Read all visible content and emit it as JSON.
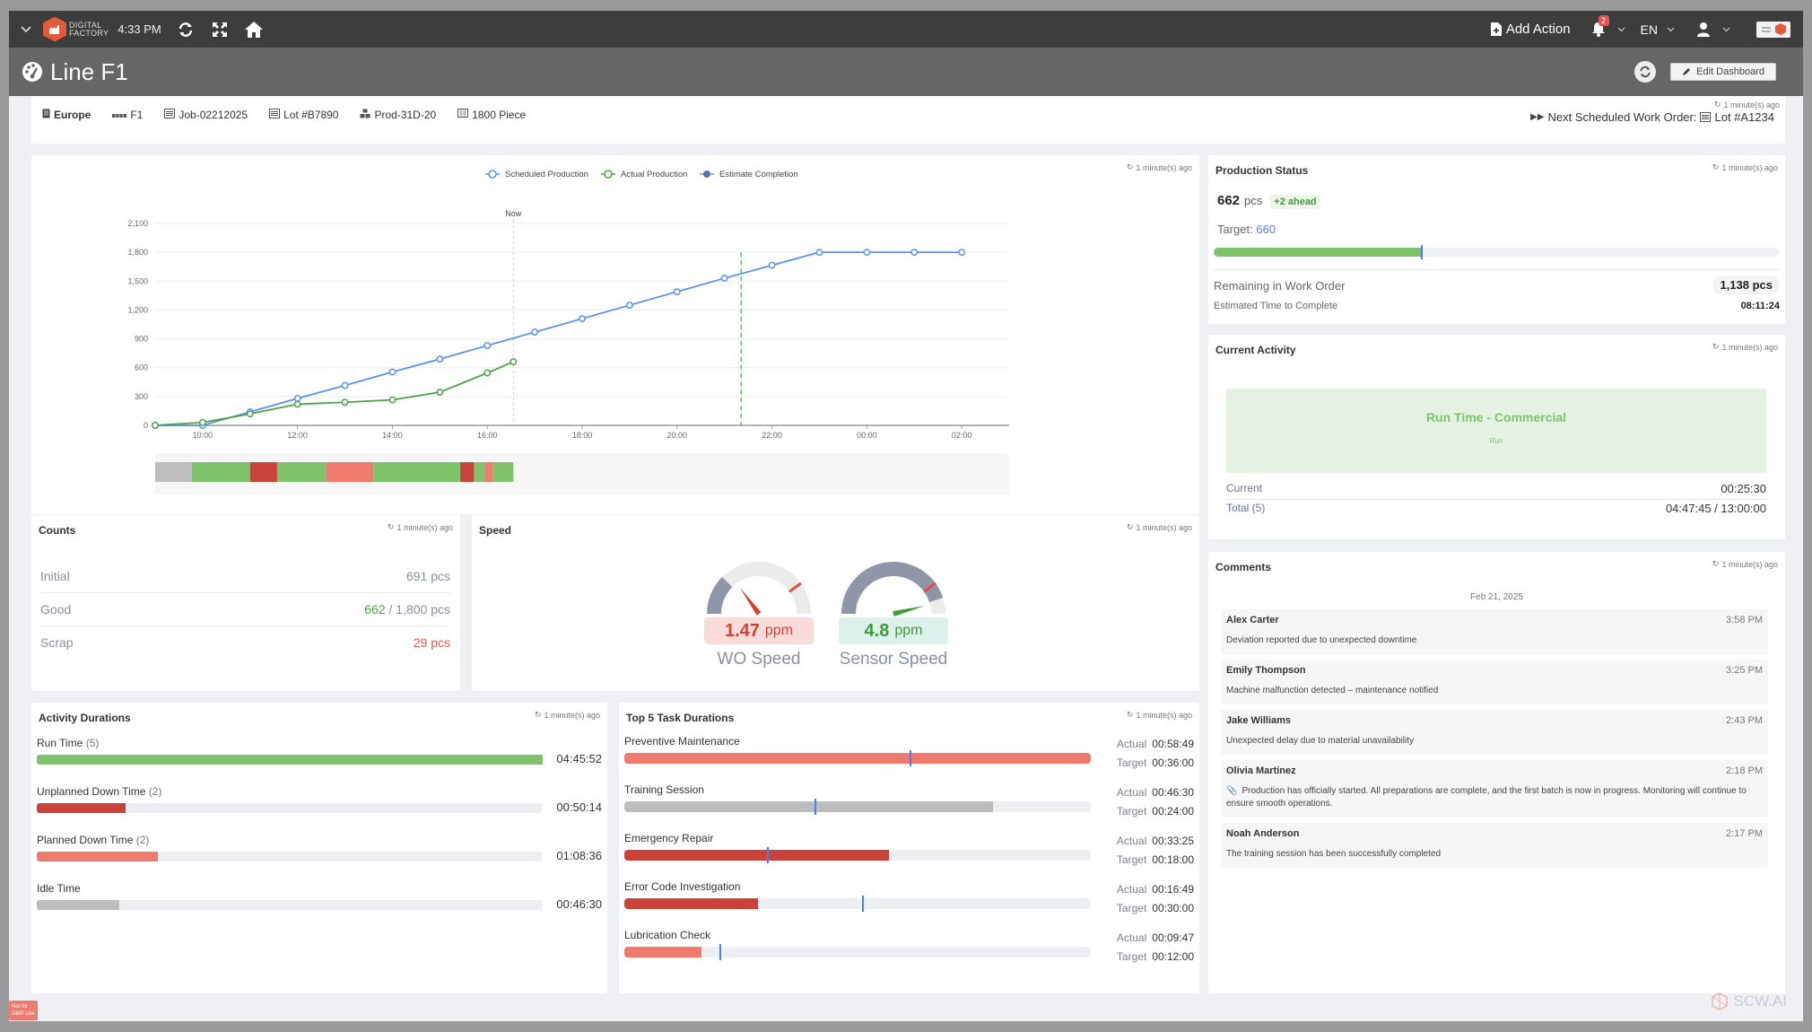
{
  "topbar": {
    "logo_line1": "DIGITAL",
    "logo_line2": "FACTORY",
    "time": "4:33 PM",
    "add_action_label": "Add Action",
    "notification_count": "2",
    "language": "EN",
    "icons": [
      "chevron-down-icon",
      "refresh-icon",
      "fullscreen-icon",
      "home-icon",
      "file-plus-icon",
      "bell-icon",
      "user-icon",
      "app-switch-icon"
    ]
  },
  "titlebar": {
    "title": "Line F1",
    "edit_dashboard_label": "Edit Dashboard"
  },
  "infobar": {
    "items": [
      {
        "icon": "building-icon",
        "label": "Europe"
      },
      {
        "icon": "line-icon",
        "label": "F1"
      },
      {
        "icon": "list-icon",
        "label": "Job-02212025"
      },
      {
        "icon": "list-icon",
        "label": "Lot #B7890"
      },
      {
        "icon": "boxes-icon",
        "label": "Prod-31D-20"
      },
      {
        "icon": "flag-icon",
        "label": "1800 Piece"
      }
    ],
    "updated": "1 minute(s) ago",
    "next_wo_label": "Next Scheduled Work Order:",
    "next_wo_value": "Lot #A1234"
  },
  "chart_panel": {
    "updated": "1 minute(s) ago"
  },
  "chart_data": {
    "type": "line",
    "title": "",
    "xlabel": "",
    "ylabel": "",
    "legend": [
      "Scheduled Production",
      "Actual Production",
      "Estimate Completion"
    ],
    "legend_position": "top-center",
    "x": [
      "09:00",
      "10:00",
      "11:00",
      "12:00",
      "13:00",
      "14:00",
      "15:00",
      "16:00",
      "17:00",
      "18:00",
      "19:00",
      "20:00",
      "21:00",
      "22:00",
      "23:00",
      "00:00",
      "01:00",
      "02:00"
    ],
    "x_hours": [
      9,
      10,
      11,
      12,
      13,
      14,
      15,
      16,
      17,
      18,
      19,
      20,
      21,
      22,
      23,
      24,
      25,
      26
    ],
    "xtick_labels": [
      "10:00",
      "12:00",
      "14:00",
      "16:00",
      "18:00",
      "20:00",
      "22:00",
      "00:00",
      "02:00"
    ],
    "xtick_hours": [
      10,
      12,
      14,
      16,
      18,
      20,
      22,
      24,
      26
    ],
    "xlim_hours": [
      9,
      27
    ],
    "ylim": [
      0,
      2100
    ],
    "yticks": [
      0,
      300,
      600,
      900,
      1200,
      1500,
      1800,
      2100
    ],
    "ytick_labels": [
      "0",
      "300",
      "600",
      "900",
      "1,200",
      "1,500",
      "1,800",
      "2,100"
    ],
    "grid": true,
    "series": [
      {
        "name": "Scheduled Production",
        "color": "#5b8ff0",
        "hours": [
          9,
          10,
          11,
          12,
          13,
          14,
          15,
          16,
          17,
          18,
          19,
          20,
          21,
          22,
          23,
          24,
          25,
          26
        ],
        "values": [
          0,
          0,
          140,
          280,
          415,
          555,
          690,
          830,
          970,
          1110,
          1250,
          1390,
          1530,
          1665,
          1800,
          1800,
          1800,
          1800
        ]
      },
      {
        "name": "Actual Production",
        "color": "#4ea048",
        "hours": [
          9,
          10,
          11,
          12,
          13,
          14,
          15,
          16,
          16.55
        ],
        "values": [
          0,
          30,
          120,
          220,
          240,
          265,
          345,
          545,
          662
        ]
      }
    ],
    "now_line": {
      "label": "Now",
      "hour": 16.55
    },
    "estimate_completion": {
      "hour": 21.35,
      "color": "#5fbf5a"
    },
    "timeline": {
      "start_hour": 9,
      "segments": [
        {
          "state": "idle",
          "from": 9.0,
          "to": 9.77,
          "color": "#bdbdbd"
        },
        {
          "state": "run",
          "from": 9.77,
          "to": 11.0,
          "color": "#7ec36b"
        },
        {
          "state": "unplanned-down",
          "from": 11.0,
          "to": 11.57,
          "color": "#c9433a"
        },
        {
          "state": "run",
          "from": 11.57,
          "to": 12.6,
          "color": "#7ec36b"
        },
        {
          "state": "planned-down",
          "from": 12.6,
          "to": 13.6,
          "color": "#ef7b6e"
        },
        {
          "state": "run",
          "from": 13.6,
          "to": 15.43,
          "color": "#7ec36b"
        },
        {
          "state": "unplanned-down",
          "from": 15.43,
          "to": 15.72,
          "color": "#c9433a"
        },
        {
          "state": "run",
          "from": 15.72,
          "to": 15.95,
          "color": "#7ec36b"
        },
        {
          "state": "planned-down",
          "from": 15.95,
          "to": 16.12,
          "color": "#ef7b6e"
        },
        {
          "state": "run",
          "from": 16.12,
          "to": 16.55,
          "color": "#7ec36b"
        }
      ]
    }
  },
  "production_status": {
    "title": "Production Status",
    "updated": "1 minute(s) ago",
    "count": "662",
    "unit": "pcs",
    "ahead_badge": "+2 ahead",
    "target_label": "Target:",
    "target_value": "660",
    "progress_fraction": 0.368,
    "target_fraction": 0.367,
    "remaining_label": "Remaining in Work Order",
    "remaining_value": "1,138 pcs",
    "etc_label": "Estimated Time to Complete",
    "etc_value": "08:11:24"
  },
  "current_activity": {
    "title": "Current Activity",
    "updated": "1 minute(s) ago",
    "activity_name": "Run Time - Commercial",
    "activity_type": "Run",
    "current_label": "Current",
    "current_value": "00:25:30",
    "total_label": "Total (5)",
    "total_value": "04:47:45 / 13:00:00"
  },
  "comments": {
    "title": "Comments",
    "updated": "1 minute(s) ago",
    "date": "Feb 21, 2025",
    "items": [
      {
        "author": "Alex Carter",
        "time": "3:58 PM",
        "text": "Deviation reported due to unexpected downtime",
        "attachment": false
      },
      {
        "author": "Emily Thompson",
        "time": "3:25 PM",
        "text": "Machine malfunction detected – maintenance notified",
        "attachment": false
      },
      {
        "author": "Jake Williams",
        "time": "2:43 PM",
        "text": "Unexpected delay due to material unavailability",
        "attachment": false
      },
      {
        "author": "Olivia Martinez",
        "time": "2:18 PM",
        "text": "Production has officially started. All preparations are complete, and the first batch is now in progress. Monitoring will continue to ensure smooth operations.",
        "attachment": true
      },
      {
        "author": "Noah Anderson",
        "time": "2:17 PM",
        "text": "The training session has been successfully completed",
        "attachment": false
      }
    ]
  },
  "counts": {
    "title": "Counts",
    "updated": "1 minute(s) ago",
    "initial_label": "Initial",
    "initial_value": "691 pcs",
    "good_label": "Good",
    "good_value": "662",
    "good_total": " / 1,800 pcs",
    "scrap_label": "Scrap",
    "scrap_value": "29 pcs"
  },
  "speed": {
    "title": "Speed",
    "updated": "1 minute(s) ago",
    "gauges": [
      {
        "label": "WO Speed",
        "value": "1.47",
        "unit": "ppm",
        "value_fraction": 0.3,
        "fill_fraction": 0.25,
        "target_fraction": 0.8,
        "status": "below",
        "color": "#d64034",
        "bg": "#f9dcda"
      },
      {
        "label": "Sensor Speed",
        "value": "4.8",
        "unit": "ppm",
        "value_fraction": 0.92,
        "fill_fraction": 0.9,
        "target_fraction": 0.8,
        "status": "above",
        "color": "#3f9a3a",
        "bg": "#ddf0ec"
      }
    ]
  },
  "activity_durations": {
    "title": "Activity Durations",
    "updated": "1 minute(s) ago",
    "items": [
      {
        "label": "Run Time",
        "count": "(5)",
        "value": "04:45:52",
        "fraction": 1.0,
        "color": "#7ec36b"
      },
      {
        "label": "Unplanned Down Time",
        "count": "(2)",
        "value": "00:50:14",
        "fraction": 0.176,
        "color": "#c9433a"
      },
      {
        "label": "Planned Down Time",
        "count": "(2)",
        "value": "01:08:36",
        "fraction": 0.24,
        "color": "#ef7b6e"
      },
      {
        "label": "Idle Time",
        "count": "",
        "value": "00:46:30",
        "fraction": 0.163,
        "color": "#bdbdbd"
      }
    ]
  },
  "top_tasks": {
    "title": "Top 5 Task Durations",
    "updated": "1 minute(s) ago",
    "actual_label": "Actual",
    "target_label": "Target",
    "items": [
      {
        "label": "Preventive Maintenance",
        "actual": "00:58:49",
        "target": "00:36:00",
        "actual_fraction": 1.0,
        "target_fraction": 0.612,
        "color": "#ef7b6e"
      },
      {
        "label": "Training Session",
        "actual": "00:46:30",
        "target": "00:24:00",
        "actual_fraction": 0.79,
        "target_fraction": 0.408,
        "color": "#bdbdbd"
      },
      {
        "label": "Emergency Repair",
        "actual": "00:33:25",
        "target": "00:18:00",
        "actual_fraction": 0.568,
        "target_fraction": 0.306,
        "color": "#c9433a"
      },
      {
        "label": "Error Code Investigation",
        "actual": "00:16:49",
        "target": "00:30:00",
        "actual_fraction": 0.286,
        "target_fraction": 0.51,
        "color": "#c9433a"
      },
      {
        "label": "Lubrication Check",
        "actual": "00:09:47",
        "target": "00:12:00",
        "actual_fraction": 0.166,
        "target_fraction": 0.204,
        "color": "#ef7b6e"
      }
    ]
  },
  "footer": {
    "gmp_badge": "Not for GMP Use",
    "watermark": "SCW.AI"
  }
}
